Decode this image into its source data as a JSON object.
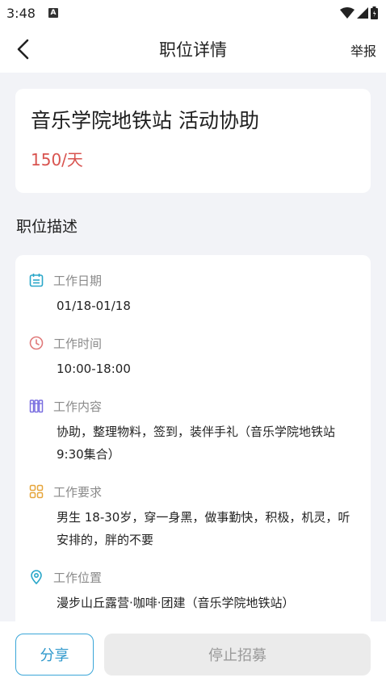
{
  "status_bar": {
    "time": "3:48",
    "notification_badge": "A"
  },
  "nav": {
    "title": "职位详情",
    "report_label": "举报"
  },
  "job": {
    "title": "音乐学院地铁站 活动协助",
    "salary": "150/天"
  },
  "section_title": "职位描述",
  "details": [
    {
      "icon": "calendar-icon",
      "label": "工作日期",
      "value": "01/18-01/18",
      "color": "#2aa7c9"
    },
    {
      "icon": "clock-icon",
      "label": "工作时间",
      "value": "10:00-18:00",
      "color": "#e07a7a"
    },
    {
      "icon": "content-icon",
      "label": "工作内容",
      "value": "协助，整理物料，签到，装伴手礼（音乐学院地铁站9:30集合）",
      "color": "#7a6fe0"
    },
    {
      "icon": "requirements-icon",
      "label": "工作要求",
      "value": "男生 18-30岁，穿一身黑，做事勤快，积极，机灵，听安排的，胖的不要",
      "color": "#e6a53a"
    },
    {
      "icon": "location-icon",
      "label": "工作位置",
      "value": "漫步山丘露营·咖啡·团建（音乐学院地铁站）",
      "color": "#2aa7c9"
    }
  ],
  "bottom": {
    "share_label": "分享",
    "stop_label": "停止招募"
  },
  "colors": {
    "salary": "#d8534f",
    "share_border": "#3aa6d8"
  }
}
